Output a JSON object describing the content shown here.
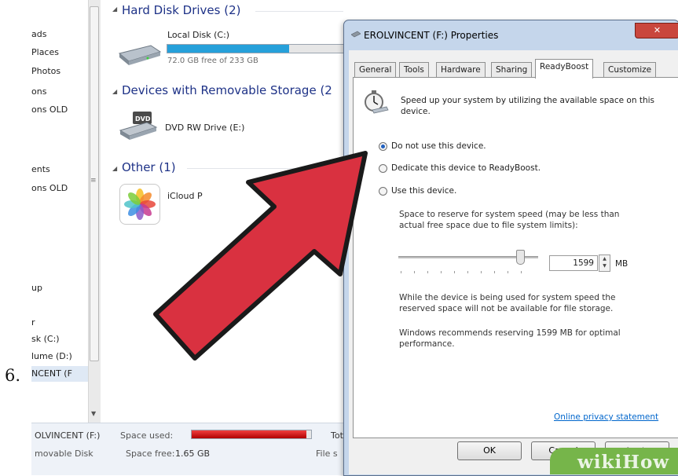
{
  "step_number": "6.",
  "nav_pane": {
    "items": [
      "ads",
      "Places",
      "Photos",
      "ons",
      "ons OLD",
      "ents",
      "ons OLD",
      "up",
      "r",
      "sk (C:)",
      "lume (D:)",
      "NCENT (F"
    ]
  },
  "explorer": {
    "groups": {
      "hard_disk": "Hard Disk Drives (2)",
      "removable": "Devices with Removable Storage (2",
      "other": "Other (1)"
    },
    "local_disk": {
      "label": "Local Disk (C:)",
      "free": "72.0 GB free of 233 GB",
      "used_fraction": 0.69
    },
    "dvd": {
      "label": "DVD RW Drive (E:)",
      "badge": "DVD"
    },
    "icloud": {
      "label": "iCloud P"
    },
    "status": {
      "name": "OLVINCENT (F:)",
      "space_used_label": "Space used:",
      "tot_label": "Tot",
      "type": "movable Disk",
      "space_free_label": "Space free:",
      "space_free_value": "1.65 GB",
      "file_label": "File s"
    }
  },
  "dialog": {
    "title": "EROLVINCENT (F:) Properties",
    "tabs": [
      "General",
      "Tools",
      "Hardware",
      "Sharing",
      "ReadyBoost",
      "Customize"
    ],
    "active_tab": "ReadyBoost",
    "intro": "Speed up your system by utilizing the available space on this device.",
    "options": [
      "Do not use this device.",
      "Dedicate this device to ReadyBoost.",
      "Use this device."
    ],
    "selected_option": 0,
    "reserve_label": "Space to reserve for system speed (may be less than actual free space due to file system limits):",
    "spin_value": "1599",
    "unit": "MB",
    "note1": "While the device is being used for system speed the reserved space will not be available for file storage.",
    "note2": "Windows recommends reserving 1599 MB for optimal performance.",
    "privacy_link": "Online privacy statement",
    "buttons": {
      "ok": "OK",
      "cancel": "Cancel",
      "apply": "Apply"
    }
  },
  "watermark": "wikiHow",
  "colors": {
    "arrow": "#d93140",
    "accent": "#1f5fbf",
    "progress_used": "#d40000",
    "drive_bar": "#26a0da",
    "watermark": "#76b54a"
  }
}
